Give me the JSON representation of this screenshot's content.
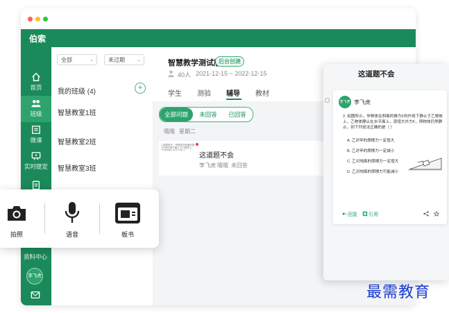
{
  "window": {
    "dots": [
      "#ff5f57",
      "#ffbd2e",
      "#28c840"
    ],
    "brand": "伯索",
    "accent": "#1b8a5a"
  },
  "nav": {
    "items": [
      {
        "label": "首页",
        "icon": "home-icon"
      },
      {
        "label": "班级",
        "icon": "people-icon",
        "active": true
      },
      {
        "label": "微课",
        "icon": "video-lesson-icon"
      },
      {
        "label": "实时提定",
        "icon": "screen-chat-icon"
      },
      {
        "label": "",
        "icon": "document-icon"
      }
    ],
    "partial_label": "资料中心",
    "user_avatar": "李飞虎",
    "mail_icon": "mail-icon"
  },
  "classlist": {
    "filter_all": "全部",
    "filter_status": "未过期",
    "heading": "我的班级 (4)",
    "classes": [
      "智慧教室1班",
      "智慧教室2班",
      "智慧教室3班"
    ]
  },
  "main": {
    "class_name": "智慧教学测试版",
    "tag": "后台创建",
    "students": "40人",
    "date_range": "2021-12-15 ~ 2022-12-15",
    "tabs": [
      "学生",
      "测验",
      "辅导",
      "教材"
    ],
    "active_tab": 2,
    "segments": [
      "全部问题",
      "未回答",
      "已回答"
    ],
    "filters": [
      "哦哦",
      "星期二"
    ],
    "question": {
      "thumb_text": "2.如图所示，甲物体在斜面的推力F的作用下静止于乙物体上，乙物体静止在水平面上",
      "title": "这道题不会",
      "author": "李飞虎",
      "time": "哦哦",
      "status": "未回答"
    }
  },
  "panel": {
    "title": "这道题不会",
    "avatar": "李飞虎",
    "name": "李飞虎",
    "question_text": "2. 如图所示，甲物体在斜面的推力F的作用下静止于乙物体上，乙物体静止在水平面上，现增大外力F，两物体仍然静止，则下列说法正确的是（ ）",
    "options": [
      "A. 乙对甲的摩擦力一定增大",
      "B. 乙对甲的摩擦力一定减小",
      "C. 乙对地面的摩擦力一定增大",
      "D. 乙对地面的摩擦力可能减小"
    ],
    "reply": "回复",
    "quote": "引用"
  },
  "tools": [
    {
      "label": "拍照",
      "icon": "camera-icon"
    },
    {
      "label": "语音",
      "icon": "microphone-icon"
    },
    {
      "label": "板书",
      "icon": "blackboard-icon"
    }
  ],
  "watermark": "最需教育"
}
